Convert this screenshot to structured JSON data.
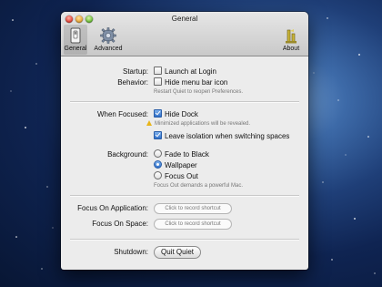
{
  "window": {
    "title": "General"
  },
  "toolbar": {
    "items": [
      {
        "label": "General"
      },
      {
        "label": "Advanced"
      },
      {
        "label": "About"
      }
    ]
  },
  "general": {
    "startup_label": "Startup:",
    "launch_at_login": {
      "label": "Launch at Login",
      "checked": false
    },
    "behavior_label": "Behavior:",
    "hide_menu_bar_icon": {
      "label": "Hide menu bar icon",
      "checked": false
    },
    "restart_note": "Restart Quiet to reopen Preferences.",
    "when_focused_label": "When Focused:",
    "hide_dock": {
      "label": "Hide Dock",
      "checked": true
    },
    "minimized_note": "Minimized applications will be revealed.",
    "leave_isolation": {
      "label": "Leave isolation when switching spaces",
      "checked": true
    },
    "background_label": "Background:",
    "background_options": [
      {
        "label": "Fade to Black",
        "selected": false
      },
      {
        "label": "Wallpaper",
        "selected": true
      },
      {
        "label": "Focus Out",
        "selected": false
      }
    ],
    "focus_out_note": "Focus Out demands a powerful Mac.",
    "focus_on_application_label": "Focus On Application:",
    "focus_on_application_shortcut": "Click to record shortcut",
    "focus_on_space_label": "Focus On Space:",
    "focus_on_space_shortcut": "Click to record shortcut",
    "shutdown_label": "Shutdown:",
    "quit_button": "Quit Quiet"
  }
}
